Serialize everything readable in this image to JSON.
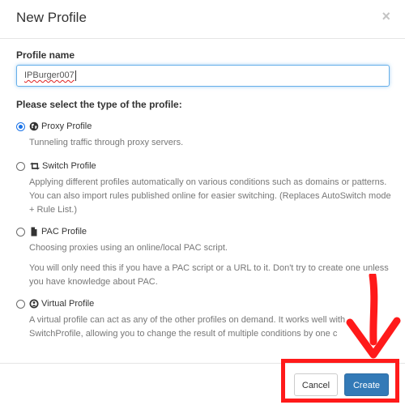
{
  "dialog": {
    "title": "New Profile",
    "close_symbol": "×"
  },
  "form": {
    "name_label": "Profile name",
    "name_value": "IPBurger007",
    "type_label": "Please select the type of the profile:"
  },
  "options": [
    {
      "title": "Proxy Profile",
      "icon": "globe-icon",
      "checked": true,
      "desc": [
        "Tunneling traffic through proxy servers."
      ]
    },
    {
      "title": "Switch Profile",
      "icon": "retweet-icon",
      "checked": false,
      "desc": [
        "Applying different profiles automatically on various conditions such as domains or patterns. You can also import rules published online for easier switching. (Replaces AutoSwitch mode + Rule List.)"
      ]
    },
    {
      "title": "PAC Profile",
      "icon": "file-icon",
      "checked": false,
      "desc": [
        "Choosing proxies using an online/local PAC script.",
        "You will only need this if you have a PAC script or a URL to it. Don't try to create one unless you have knowledge about PAC."
      ]
    },
    {
      "title": "Virtual Profile",
      "icon": "virtual-profile-icon",
      "checked": false,
      "desc": [
        "A virtual profile can act as any of the other profiles on demand. It works well with SwitchProfile, allowing you to change the result of multiple conditions by one c"
      ]
    }
  ],
  "footer": {
    "cancel_label": "Cancel",
    "create_label": "Create"
  },
  "colors": {
    "primary": "#337ab7",
    "annotation": "#ff1a1a",
    "radio_selected": "#1a73e8"
  }
}
